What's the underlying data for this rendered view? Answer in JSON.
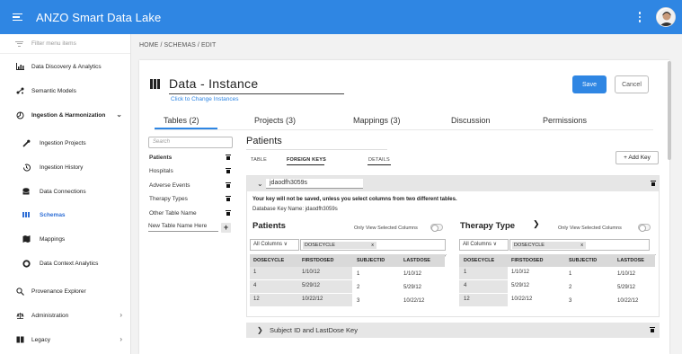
{
  "app": {
    "title": "ANZO Smart Data Lake"
  },
  "sidebar": {
    "filter_placeholder": "Filter menu items",
    "items": [
      {
        "label": "Data Discovery & Analytics",
        "icon": "chart-icon"
      },
      {
        "label": "Semantic Models",
        "icon": "graph-icon"
      },
      {
        "label": "Ingestion & Harmonization",
        "icon": "ingestion-icon"
      },
      {
        "label": "Ingestion Projects",
        "icon": "wrench-icon"
      },
      {
        "label": "Ingestion History",
        "icon": "history-icon"
      },
      {
        "label": "Data Connections",
        "icon": "database-icon"
      },
      {
        "label": "Schemas",
        "icon": "schema-icon"
      },
      {
        "label": "Mappings",
        "icon": "mapping-icon"
      },
      {
        "label": "Data Context Analytics",
        "icon": "settings-icon"
      },
      {
        "label": "Provenance Explorer",
        "icon": "search-icon"
      },
      {
        "label": "Administration",
        "icon": "admin-icon"
      },
      {
        "label": "Legacy",
        "icon": "book-icon"
      }
    ]
  },
  "breadcrumb": "HOME / SCHEMAS / EDIT",
  "instance": {
    "title": "Data - Instance",
    "change_link": "Click to Change Instances",
    "save": "Save",
    "cancel": "Cancel"
  },
  "tabs": [
    {
      "label": "Tables (2)"
    },
    {
      "label": "Projects (3)"
    },
    {
      "label": "Mappings (3)"
    },
    {
      "label": "Discussion"
    },
    {
      "label": "Permissions"
    }
  ],
  "tables": {
    "search_placeholder": "Search",
    "items": [
      "Patients",
      "Hospitals",
      "Adverse Events",
      "Therapy Types",
      "Other Table Name"
    ],
    "new_table": "New Table Name Here",
    "add_symbol": "+"
  },
  "detail": {
    "title": "Patients",
    "subtabs": [
      "TABLE",
      "FOREIGN KEYS",
      "DETAILS"
    ],
    "add_key": "+ Add Key"
  },
  "foreign_key": {
    "name": "jdaodfh3059s",
    "warning": "Your key will not be saved, unless you select columns from two different tables.",
    "db_name_label": "Database Key Name: jdaodfh3059s",
    "left": {
      "title": "Patients",
      "only_view": "Only View Selected Columns",
      "columns_select": "All Columns ∨",
      "chip": "DOSECYCLE",
      "chip_x": "x",
      "headers": [
        "DOSECYCLE",
        "FIRSTDOSED",
        "SUBJECTID",
        "LASTDOSE"
      ],
      "rows": [
        [
          "1",
          "1/10/12",
          "1",
          "1/10/12"
        ],
        [
          "4",
          "5/29/12",
          "2",
          "5/29/12"
        ],
        [
          "12",
          "10/22/12",
          "3",
          "10/22/12"
        ]
      ]
    },
    "right": {
      "title": "Therapy Type",
      "only_view": "Only View Selected Columns",
      "columns_select": "All Columns ∨",
      "chip": "DOSECYCLE",
      "chip_x": "x",
      "headers": [
        "DOSECYCLE",
        "FIRSTDOSED",
        "SUBJECTID",
        "LASTDOSE"
      ],
      "rows": [
        [
          "1",
          "1/10/12",
          "1",
          "1/10/12"
        ],
        [
          "4",
          "5/29/12",
          "2",
          "5/29/12"
        ],
        [
          "12",
          "10/22/12",
          "3",
          "10/22/12"
        ]
      ]
    }
  },
  "collapsed_key": {
    "name": "Subject ID and LastDose Key"
  },
  "colors": {
    "primary": "#2f86e3",
    "active_nav": "#2f6fd6"
  }
}
